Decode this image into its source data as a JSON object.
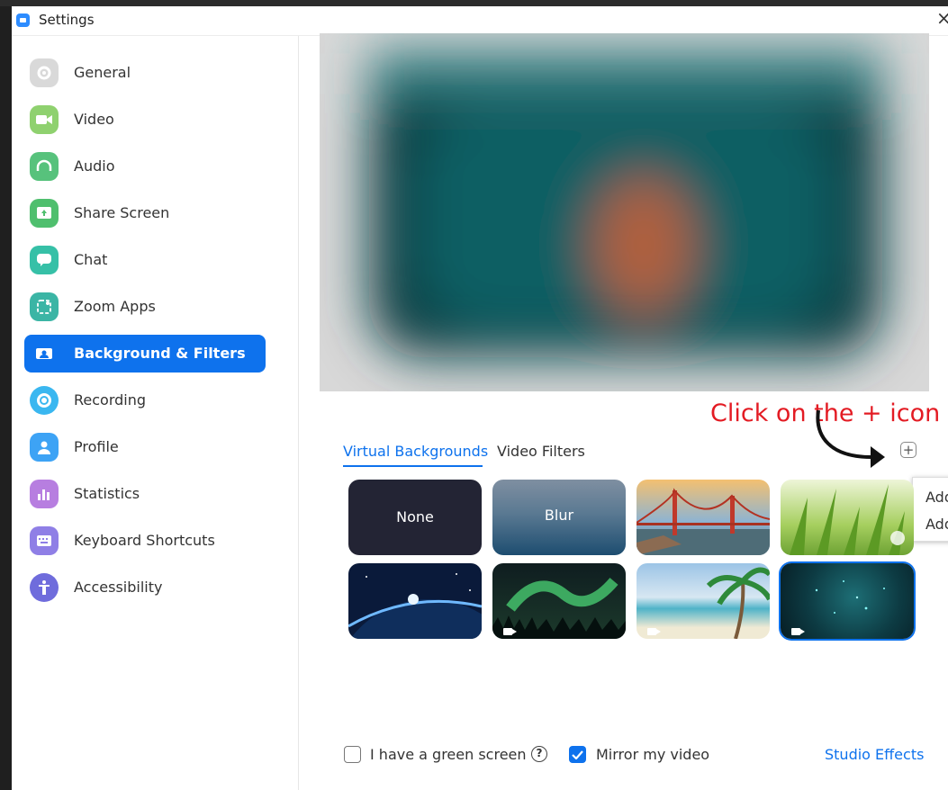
{
  "window": {
    "title": "Settings",
    "close_glyph": "×"
  },
  "sidebar": {
    "items": [
      {
        "label": "General",
        "icon": "gear-icon",
        "color": "#cfcfcf"
      },
      {
        "label": "Video",
        "icon": "video-camera-icon",
        "color": "#8fd16f"
      },
      {
        "label": "Audio",
        "icon": "headphones-icon",
        "color": "#57c27c"
      },
      {
        "label": "Share Screen",
        "icon": "share-screen-icon",
        "color": "#4fbf6e"
      },
      {
        "label": "Chat",
        "icon": "chat-bubble-icon",
        "color": "#36c0a7"
      },
      {
        "label": "Zoom Apps",
        "icon": "apps-icon",
        "color": "#3bb5a5"
      },
      {
        "label": "Background & Filters",
        "icon": "background-icon",
        "color": "#0e72ed",
        "active": true
      },
      {
        "label": "Recording",
        "icon": "recording-icon",
        "color": "#3ab7f0"
      },
      {
        "label": "Profile",
        "icon": "profile-icon",
        "color": "#3da3f5"
      },
      {
        "label": "Statistics",
        "icon": "statistics-icon",
        "color": "#b77ee0"
      },
      {
        "label": "Keyboard Shortcuts",
        "icon": "keyboard-icon",
        "color": "#8f7fe6"
      },
      {
        "label": "Accessibility",
        "icon": "accessibility-icon",
        "color": "#6f6cdc"
      }
    ]
  },
  "annotation": {
    "text": "Click on the + icon",
    "color": "#e31b23"
  },
  "tabs": {
    "virtual_backgrounds": "Virtual Backgrounds",
    "video_filters": "Video Filters"
  },
  "add_button": {
    "glyph": "+"
  },
  "add_menu": {
    "items": [
      "Add",
      "Add"
    ]
  },
  "backgrounds": [
    {
      "label": "None",
      "icon": "",
      "selected": false
    },
    {
      "label": "Blur",
      "icon": "",
      "selected": false
    },
    {
      "label": "",
      "icon": "golden-gate-bridge-image",
      "selected": false
    },
    {
      "label": "",
      "icon": "grass-image",
      "selected": false
    },
    {
      "label": "",
      "icon": "earth-from-space-image",
      "selected": false
    },
    {
      "label": "",
      "icon": "aurora-image",
      "selected": false
    },
    {
      "label": "",
      "icon": "beach-palm-image",
      "selected": false
    },
    {
      "label": "",
      "icon": "teal-particles-image",
      "selected": true
    }
  ],
  "footer": {
    "green_screen_label": "I have a green screen",
    "green_screen_checked": false,
    "help_glyph": "?",
    "mirror_label": "Mirror my video",
    "mirror_checked": true,
    "studio_effects": "Studio Effects"
  },
  "colors": {
    "accent": "#0e72ed",
    "preview_bg": "#0b3a40"
  }
}
